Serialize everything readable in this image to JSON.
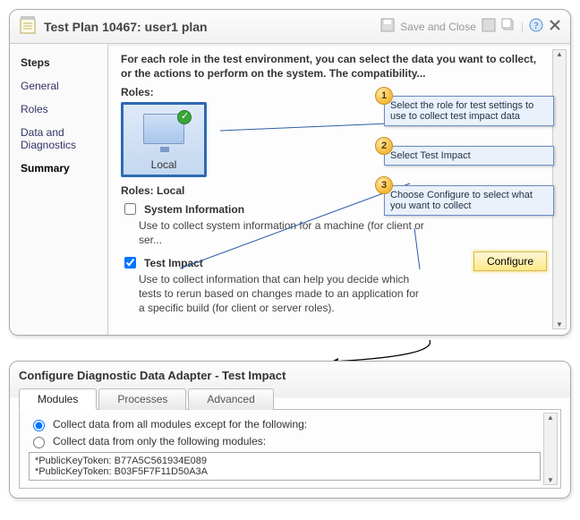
{
  "header": {
    "title": "Test Plan 10467: user1 plan",
    "save_label": "Save and Close"
  },
  "sidebar": {
    "heading": "Steps",
    "items": [
      {
        "label": "General"
      },
      {
        "label": "Roles"
      },
      {
        "label": "Data and Diagnostics"
      },
      {
        "label": "Summary",
        "active": true
      }
    ]
  },
  "content": {
    "intro": "For each role in the test environment, you can select the data you want to collect, or the actions to perform on the system. The compatibility...",
    "roles_label": "Roles:",
    "role_tile_name": "Local",
    "roles_sub": "Roles:  Local",
    "adapters": {
      "system_info": {
        "label": "System Information",
        "desc": "Use to collect system information for a machine (for client or ser...",
        "checked": false
      },
      "test_impact": {
        "label": "Test Impact",
        "desc": "Use to collect information that can help you decide which tests to rerun based on changes made to an application for a specific build (for client or server roles).",
        "checked": true,
        "configure_label": "Configure"
      }
    }
  },
  "callouts": {
    "c1": "Select the role for test settings to use to collect test impact data",
    "c2": "Select Test Impact",
    "c3": "Choose Configure to select what you want to collect"
  },
  "dialog": {
    "title": "Configure Diagnostic Data Adapter - Test Impact",
    "tabs": {
      "modules": "Modules",
      "processes": "Processes",
      "advanced": "Advanced"
    },
    "radio1": "Collect data from all modules except for the following:",
    "radio2": "Collect data from only the following modules:",
    "keys": [
      "*PublicKeyToken: B77A5C561934E089",
      "*PublicKeyToken: B03F5F7F11D50A3A"
    ]
  }
}
